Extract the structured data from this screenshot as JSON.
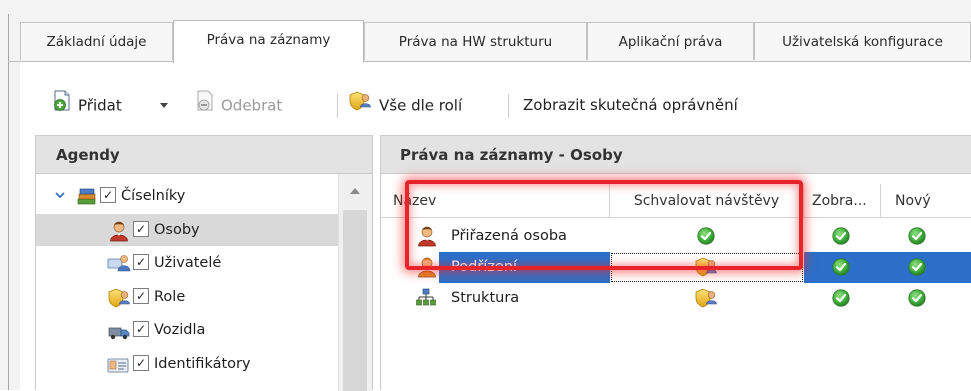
{
  "tabs": [
    "Základní údaje",
    "Práva na záznamy",
    "Práva na HW strukturu",
    "Aplikační práva",
    "Uživatelská konfigurace"
  ],
  "active_tab": "Práva na záznamy",
  "toolbar": {
    "add_label": "Přidat",
    "remove_label": "Odebrat",
    "all_by_roles_label": "Vše dle rolí",
    "show_actual_label": "Zobrazit skutečná oprávnění"
  },
  "agendy": {
    "title": "Agendy",
    "items": [
      {
        "label": "Číselníky",
        "checked": "✓",
        "icon": "books-icon"
      },
      {
        "label": "Osoby",
        "checked": "✓",
        "icon": "person-icon"
      },
      {
        "label": "Uživatelé",
        "checked": "✓",
        "icon": "users-icon"
      },
      {
        "label": "Role",
        "checked": "✓",
        "icon": "role-shield-icon"
      },
      {
        "label": "Vozidla",
        "checked": "✓",
        "icon": "vehicle-icon"
      },
      {
        "label": "Identifikátory",
        "checked": "✓",
        "icon": "id-card-icon"
      }
    ]
  },
  "prava": {
    "title": "Práva na záznamy - Osoby",
    "columns": [
      "Název",
      "Schvalovat návštěvy",
      "Zobra...",
      "Nový"
    ],
    "rows": [
      {
        "label": "Přiřazená osoba",
        "icon": "person-icon",
        "schvalovat": "green-check-icon",
        "zobrazit": "green-check-icon",
        "novy": "green-check-icon"
      },
      {
        "label": "Podřízení",
        "icon": "subordinate-person-icon",
        "schvalovat": "role-shield-icon",
        "zobrazit": "green-check-icon",
        "novy": "green-check-icon"
      },
      {
        "label": "Struktura",
        "icon": "org-structure-icon",
        "schvalovat": "role-shield-icon",
        "zobrazit": "green-check-icon",
        "novy": "green-check-icon"
      }
    ]
  },
  "colors": {
    "selection": "#2c6fc8",
    "highlight": "#e8242a",
    "check_green": "#3fae3c"
  }
}
